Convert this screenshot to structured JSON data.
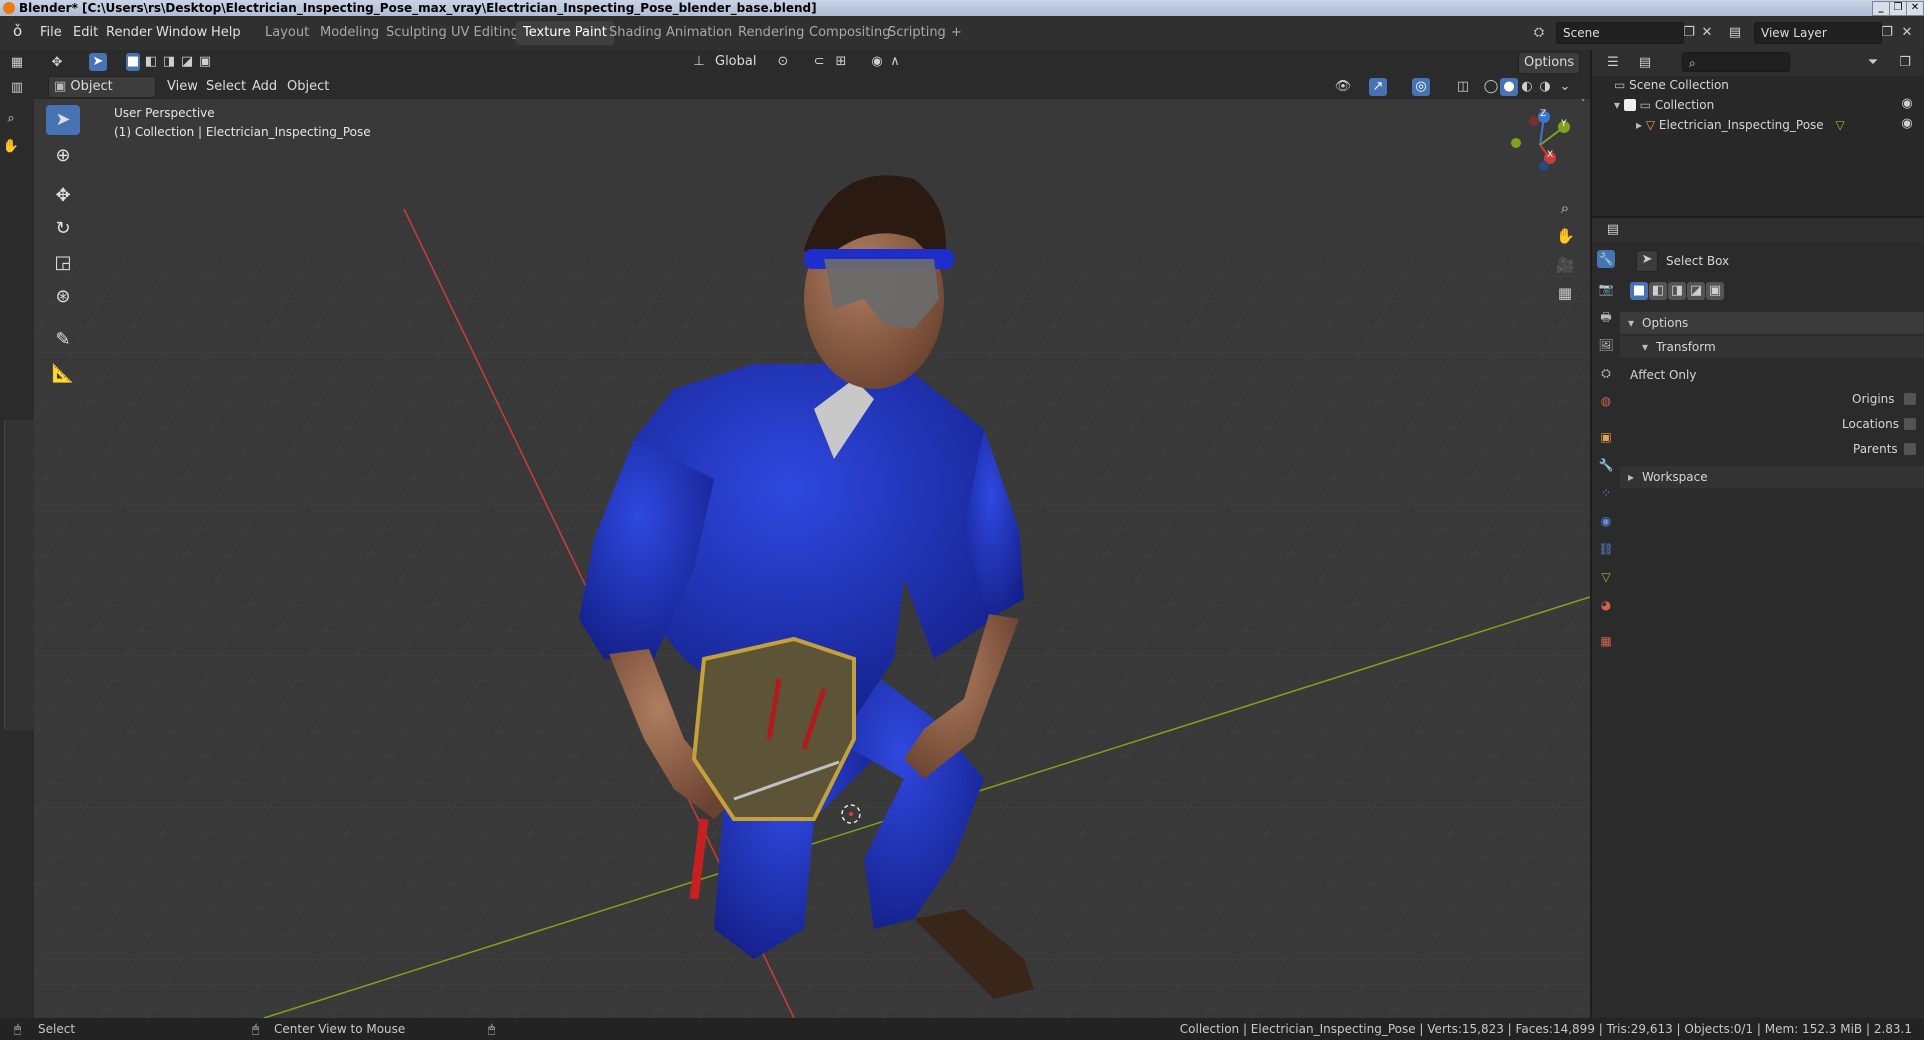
{
  "window": {
    "title": "Blender* [C:\\Users\\rs\\Desktop\\Electrician_Inspecting_Pose_max_vray\\Electrician_Inspecting_Pose_blender_base.blend]",
    "controls": [
      "_",
      "❐",
      "✕"
    ]
  },
  "menu": [
    "File",
    "Edit",
    "Render",
    "Window",
    "Help"
  ],
  "workspaces": [
    "Layout",
    "Modeling",
    "Sculpting",
    "UV Editing",
    "Texture Paint",
    "Shading",
    "Animation",
    "Rendering",
    "Compositing",
    "Scripting"
  ],
  "workspace_active": "Texture Paint",
  "workspace_add": "+",
  "scene": {
    "name": "Scene",
    "view_layer": "View Layer"
  },
  "viewport_header": {
    "orientation": "Global",
    "options": "Options",
    "mode": "Object Mode",
    "menus": [
      "View",
      "Select",
      "Add",
      "Object"
    ]
  },
  "viewport": {
    "perspective": "User Perspective",
    "collection_info": "(1) Collection | Electrician_Inspecting_Pose",
    "gizmo": {
      "x": "X",
      "y": "Y",
      "z": "Z"
    }
  },
  "outliner": {
    "scene_collection": "Scene Collection",
    "collection": "Collection",
    "object": "Electrician_Inspecting_Pose"
  },
  "properties": {
    "tool_name": "Select Box",
    "options_label": "Options",
    "transform_label": "Transform",
    "affect_only": "Affect Only",
    "origins": "Origins",
    "locations": "Locations",
    "parents": "Parents",
    "workspace_label": "Workspace"
  },
  "statusbar": {
    "left_action": "Select",
    "middle_action": "Center View to Mouse",
    "stats": "Collection | Electrician_Inspecting_Pose | Verts:15,823 | Faces:14,899 | Tris:29,613 | Objects:0/1 | Mem: 152.3 MiB | 2.83.1"
  },
  "colors": {
    "accent": "#4772b3",
    "viewport_bg": "#393939",
    "x_axis": "#c93d3d",
    "y_axis": "#7ea31e",
    "z_axis": "#3a78d0",
    "overall_blue": "#1c2fb0"
  }
}
